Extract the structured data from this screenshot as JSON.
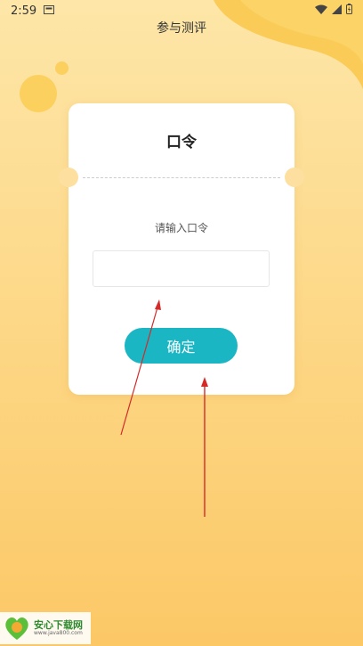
{
  "status_bar": {
    "time": "2:59"
  },
  "header": {
    "title": "参与测评"
  },
  "card": {
    "title": "口令",
    "prompt": "请输入口令",
    "input_value": "",
    "input_placeholder": "",
    "confirm_label": "确定"
  },
  "watermark": {
    "title": "安心下载网",
    "url": "www.java800.com"
  },
  "colors": {
    "accent": "#1ab6c4",
    "background": "#fdd98a",
    "annotation_arrow": "#d42a2a"
  }
}
